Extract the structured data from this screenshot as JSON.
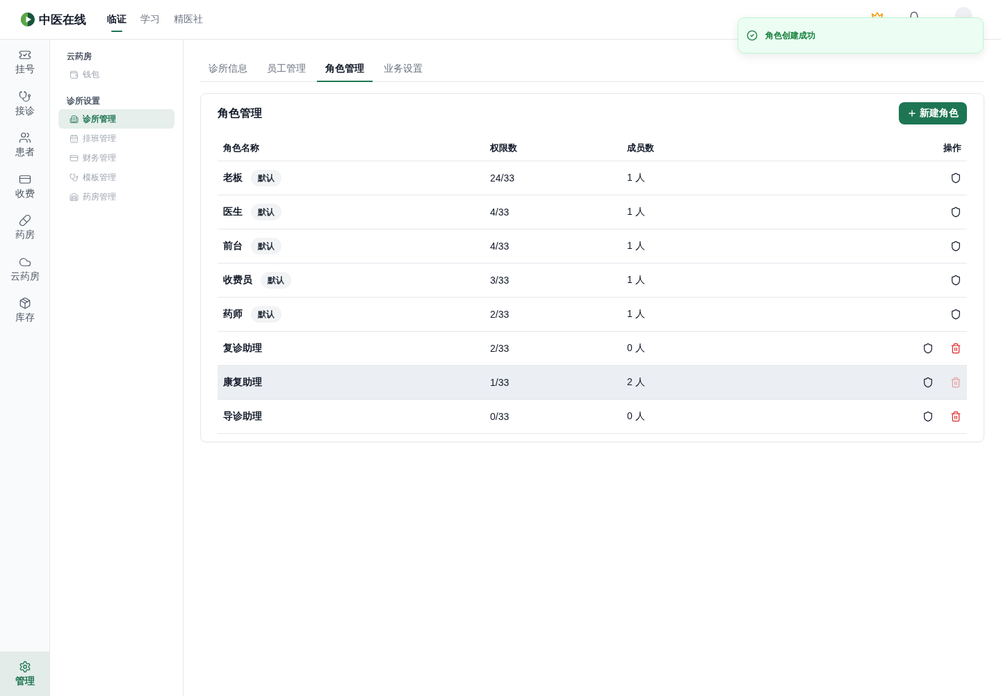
{
  "header": {
    "logo_text": "中医在线",
    "nav": [
      {
        "label": "临证",
        "selected": true
      },
      {
        "label": "学习",
        "selected": false
      },
      {
        "label": "精医社",
        "selected": false
      }
    ]
  },
  "toast": {
    "kind": "success",
    "message": "角色创建成功"
  },
  "rail": {
    "items": [
      {
        "label": "挂号",
        "selected": false
      },
      {
        "label": "接诊",
        "selected": false
      },
      {
        "label": "患者",
        "selected": false
      },
      {
        "label": "收费",
        "selected": false
      },
      {
        "label": "药房",
        "selected": false
      },
      {
        "label": "云药房",
        "selected": false
      },
      {
        "label": "库存",
        "selected": false
      }
    ],
    "footer_item": {
      "label": "管理",
      "selected": true
    }
  },
  "sidebar": {
    "groups": [
      {
        "title": "云药房",
        "items": [
          {
            "label": "钱包",
            "selected": false
          }
        ]
      },
      {
        "title": "诊所设置",
        "items": [
          {
            "label": "诊所管理",
            "selected": true
          },
          {
            "label": "排班管理",
            "selected": false
          },
          {
            "label": "财务管理",
            "selected": false
          },
          {
            "label": "模板管理",
            "selected": false
          },
          {
            "label": "药房管理",
            "selected": false
          }
        ]
      }
    ]
  },
  "tabs": [
    {
      "label": "诊所信息",
      "selected": false
    },
    {
      "label": "员工管理",
      "selected": false
    },
    {
      "label": "角色管理",
      "selected": true
    },
    {
      "label": "业务设置",
      "selected": false
    }
  ],
  "roles": {
    "title": "角色管理",
    "new_button": "新建角色",
    "columns": [
      "角色名称",
      "权限数",
      "成员数",
      "操作"
    ],
    "rows": [
      {
        "name": "老板",
        "badge": "默认",
        "permissions": "24/33",
        "members": "1 人",
        "deletable": false,
        "highlighted": false
      },
      {
        "name": "医生",
        "badge": "默认",
        "permissions": "4/33",
        "members": "1 人",
        "deletable": false,
        "highlighted": false
      },
      {
        "name": "前台",
        "badge": "默认",
        "permissions": "4/33",
        "members": "1 人",
        "deletable": false,
        "highlighted": false
      },
      {
        "name": "收费员",
        "badge": "默认",
        "permissions": "3/33",
        "members": "1 人",
        "deletable": false,
        "highlighted": false
      },
      {
        "name": "药师",
        "badge": "默认",
        "permissions": "2/33",
        "members": "1 人",
        "deletable": false,
        "highlighted": false
      },
      {
        "name": "复诊助理",
        "permissions": "2/33",
        "members": "0 人",
        "deletable": true,
        "delete_disabled": false,
        "highlighted": false
      },
      {
        "name": "康复助理",
        "permissions": "1/33",
        "members": "2 人",
        "deletable": true,
        "delete_disabled": true,
        "highlighted": true
      },
      {
        "name": "导诊助理",
        "permissions": "0/33",
        "members": "0 人",
        "deletable": true,
        "delete_disabled": false,
        "highlighted": false
      }
    ]
  }
}
